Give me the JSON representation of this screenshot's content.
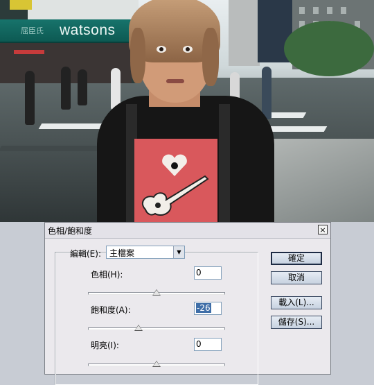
{
  "photo": {
    "store_sign": "watsons",
    "store_sign_left": "屈臣氏"
  },
  "dialog": {
    "title": "色相/飽和度",
    "close_glyph": "×",
    "edit_label": "編輯(E):",
    "edit_value": "主檔案",
    "hue": {
      "label": "色相(H):",
      "value": "0",
      "slider_fraction": 0.5
    },
    "saturation": {
      "label": "飽和度(A):",
      "value": "-26",
      "slider_fraction": 0.37
    },
    "lightness": {
      "label": "明亮(I):",
      "value": "0",
      "slider_fraction": 0.5
    },
    "buttons": {
      "ok": "確定",
      "cancel": "取消",
      "load": "載入(L)...",
      "save": "儲存(S)..."
    }
  },
  "colors": {
    "store_sign": "#17736b",
    "shirt_print": "#d9585c",
    "selection": "#3f6ea8"
  }
}
